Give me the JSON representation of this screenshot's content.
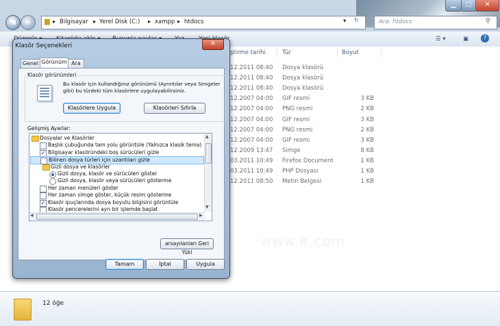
{
  "address": {
    "segments": [
      "Bilgisayar",
      "Yerel Disk (C:)",
      "xampp",
      "htdocs"
    ],
    "search_placeholder": "Ara: htdocs"
  },
  "toolbar": {
    "items": [
      "Düzenle ▾",
      "Kitaplığa ekle ▾",
      "Bununla paylaş ▾",
      "Yaz",
      "Yeni klasör"
    ]
  },
  "columns": [
    "ştirme tarihi",
    "Tür",
    "Boyut"
  ],
  "files": [
    {
      "date": "12.2011 08:40",
      "type": "Dosya klasörü",
      "size": ""
    },
    {
      "date": "12.2011 08:40",
      "type": "Dosya klasörü",
      "size": ""
    },
    {
      "date": "12.2011 08:40",
      "type": "Dosya klasörü",
      "size": ""
    },
    {
      "date": "12.2007 04:00",
      "type": "GIF resmi",
      "size": "3 KB"
    },
    {
      "date": "12.2007 04:00",
      "type": "PNG resmi",
      "size": "2 KB"
    },
    {
      "date": "12.2007 04:00",
      "type": "GIF resmi",
      "size": "3 KB"
    },
    {
      "date": "12.2007 04:00",
      "type": "PNG resmi",
      "size": "2 KB"
    },
    {
      "date": "12.2007 04:00",
      "type": "GIF resmi",
      "size": "3 KB"
    },
    {
      "date": "12.2009 13:47",
      "type": "Simge",
      "size": "8 KB"
    },
    {
      "date": "03.2011 10:49",
      "type": "Firefox Document",
      "size": "1 KB"
    },
    {
      "date": "03.2011 10:49",
      "type": "PHP Dosyası",
      "size": "1 KB"
    },
    {
      "date": "12.2011 08:50",
      "type": "Metin Belgesi",
      "size": "1 KB"
    }
  ],
  "status": {
    "count": "12 öğe"
  },
  "watermark": "www.e.com",
  "dialog": {
    "title": "Klasör Seçenekleri",
    "tabs": [
      "Genel",
      "Görünüm",
      "Ara"
    ],
    "group_title": "Klasör görünümleri",
    "group_text_1": "Bu klasör için kullandığınız görünümü (Ayrıntılar veya Simgeler",
    "group_text_2": "gibi) bu türdeki tüm klasörlere uygulayabilirsiniz.",
    "apply_button": "Klasörlere Uygula",
    "reset_button": "Klasörleri Sıfırla",
    "advanced_label": "Gelişmiş Ayarlar:",
    "tree": [
      {
        "kind": "folder",
        "label": "Dosyalar ve Klasörler",
        "checked": false
      },
      {
        "kind": "check",
        "label": "Başlık çubuğunda tam yolu görüntüle (Yalnızca klasik tema)",
        "checked": false
      },
      {
        "kind": "check",
        "label": "Bilgisayar klasöründeki boş sürücüleri gizle",
        "checked": true
      },
      {
        "kind": "check",
        "label": "Bilinen dosya türleri için uzantıları gizle",
        "checked": false
      },
      {
        "kind": "folder",
        "label": "Gizli dosya ve klasörler",
        "checked": false
      },
      {
        "kind": "radio",
        "label": "Gizli dosya, klasör ve sürücüleri göster",
        "checked": true
      },
      {
        "kind": "radio",
        "label": "Gizli dosya, klasör veya sürücüleri gösterme",
        "checked": false
      },
      {
        "kind": "check",
        "label": "Her zaman menüleri göster",
        "checked": false
      },
      {
        "kind": "check",
        "label": "Her zaman simge göster, küçük resim gösterme",
        "checked": false
      },
      {
        "kind": "check",
        "label": "Klasör ipuçlarında dosya boyutu bilgisini görüntüle",
        "checked": true
      },
      {
        "kind": "check",
        "label": "Klasör pencerelerini ayrı bir işlemde başlat",
        "checked": false
      }
    ],
    "restore_button": "arsayılanları Geri Yükl",
    "ok_button": "Tamam",
    "cancel_button": "İptal",
    "apply_bottom_button": "Uygula"
  }
}
